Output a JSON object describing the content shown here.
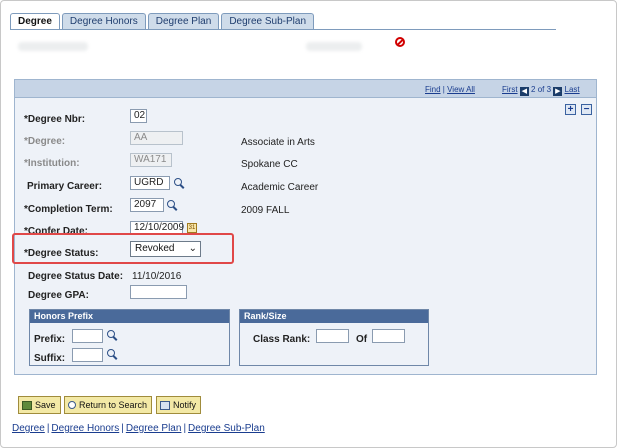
{
  "tabs": [
    {
      "label": "Degree",
      "active": true
    },
    {
      "label": "Degree Honors",
      "active": false
    },
    {
      "label": "Degree Plan",
      "active": false
    },
    {
      "label": "Degree Sub-Plan",
      "active": false
    }
  ],
  "nav": {
    "find": "Find",
    "view_all": "View All",
    "first": "First",
    "prev_icon": "previous-arrow-icon",
    "position": "2 of 3",
    "next_icon": "next-arrow-icon",
    "last": "Last"
  },
  "fields": {
    "degree_nbr": {
      "label": "*Degree Nbr:",
      "value": "02"
    },
    "degree": {
      "label": "*Degree:",
      "value": "AA",
      "description": "Associate in Arts"
    },
    "institution": {
      "label": "*Institution:",
      "value": "WA171",
      "description": "Spokane CC"
    },
    "primary_career": {
      "label": "Primary Career:",
      "value": "UGRD",
      "description": "Academic Career"
    },
    "completion_term": {
      "label": "*Completion Term:",
      "value": "2097",
      "description": "2009 FALL"
    },
    "confer_date": {
      "label": "*Confer Date:",
      "value": "12/10/2009"
    },
    "degree_status": {
      "label": "*Degree Status:",
      "value": "Revoked"
    },
    "degree_status_date": {
      "label": "Degree Status Date:",
      "value": "11/10/2016"
    },
    "degree_gpa": {
      "label": "Degree GPA:",
      "value": ""
    }
  },
  "honors_prefix": {
    "title": "Honors Prefix",
    "prefix_label": "Prefix:",
    "suffix_label": "Suffix:"
  },
  "rank_size": {
    "title": "Rank/Size",
    "class_rank_label": "Class Rank:",
    "of_label": "Of"
  },
  "toolbar": {
    "save": "Save",
    "return_to_search": "Return to Search",
    "notify": "Notify"
  },
  "bottom_links": {
    "degree": "Degree",
    "degree_honors": "Degree Honors",
    "degree_plan": "Degree Plan",
    "degree_sub_plan": "Degree Sub-Plan"
  },
  "colors": {
    "highlight": "#e04848",
    "tab_bg": "#cfdcea",
    "section_header": "#4a6a9a",
    "link": "#1a3d8f"
  }
}
